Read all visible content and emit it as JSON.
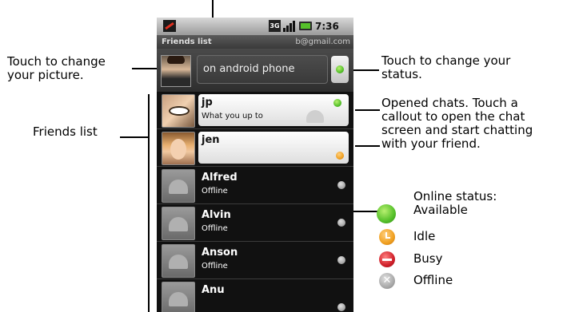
{
  "annotations": {
    "picture": [
      "Touch to change",
      "your picture."
    ],
    "status": [
      "Touch to change your",
      "status."
    ],
    "friends_list": "Friends list",
    "chats": [
      "Opened chats. Touch a",
      "callout to open the chat",
      "screen and start chatting",
      "with your friend."
    ],
    "legend_title": [
      "Online status:",
      "Available"
    ],
    "legend": [
      {
        "label": "Idle",
        "color": "#f0a020"
      },
      {
        "label": "Busy",
        "color": "#d0202a"
      },
      {
        "label": "Offline",
        "color": "#aaaaaa"
      }
    ],
    "available_color": "#55c02a"
  },
  "status_bar": {
    "network": "3G",
    "time": "7:36 AM",
    "icons": [
      "missed-call-icon",
      "signal-icon",
      "battery-icon"
    ]
  },
  "title_bar": {
    "title": "Friends list",
    "account": "b@gmail.com"
  },
  "my_status": {
    "text": "on android phone",
    "state": "available"
  },
  "friends": [
    {
      "name": "jp",
      "status_text": "What you up to",
      "state": "available",
      "chat_open": true
    },
    {
      "name": "jen",
      "status_text": "",
      "state": "idle",
      "chat_open": true
    },
    {
      "name": "Alfred",
      "status_text": "Offline",
      "state": "offline",
      "chat_open": false
    },
    {
      "name": "Alvin",
      "status_text": "Offline",
      "state": "offline",
      "chat_open": false
    },
    {
      "name": "Anson",
      "status_text": "Offline",
      "state": "offline",
      "chat_open": false
    },
    {
      "name": "Anu",
      "status_text": "",
      "state": "offline",
      "chat_open": false
    }
  ]
}
